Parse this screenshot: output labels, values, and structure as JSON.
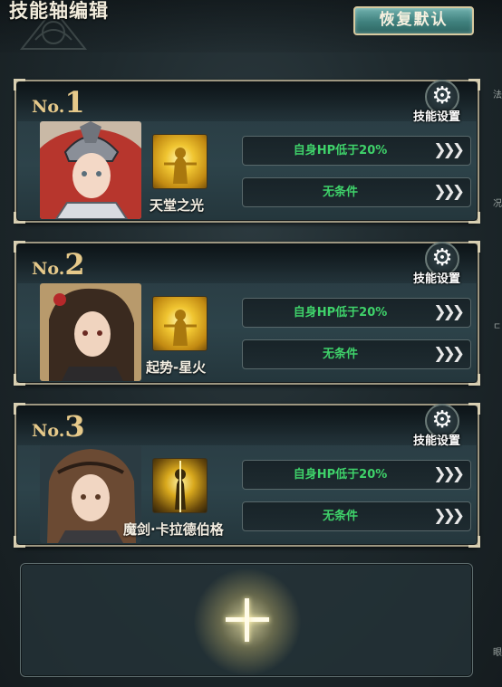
{
  "header": {
    "title": "技能轴编辑",
    "reset_button": "恢复默认"
  },
  "side_fragments": [
    "法",
    "况",
    "ㄷ",
    "眼"
  ],
  "skill_settings_label": "技能设置",
  "arrow_glyph": "❯❯❯",
  "slots": [
    {
      "no_prefix": "No.",
      "number": "1",
      "skill_name": "天堂之光",
      "conditions": [
        {
          "text": "自身HP低于20%",
          "color": "#3fd26a"
        },
        {
          "text": "无条件",
          "color": "#3fd26a"
        }
      ]
    },
    {
      "no_prefix": "No.",
      "number": "2",
      "skill_name": "起势-星火",
      "conditions": [
        {
          "text": "自身HP低于20%",
          "color": "#3fd26a"
        },
        {
          "text": "无条件",
          "color": "#3fd26a"
        }
      ]
    },
    {
      "no_prefix": "No.",
      "number": "3",
      "skill_name": "魔剑·卡拉德伯格",
      "conditions": [
        {
          "text": "自身HP低于20%",
          "color": "#3fd26a"
        },
        {
          "text": "无条件",
          "color": "#3fd26a"
        }
      ]
    }
  ],
  "add_slot": {
    "icon": "plus-icon"
  },
  "colors": {
    "accent_gold": "#e6c98a",
    "condition_green": "#3fd26a",
    "reset_teal": "#4f908d"
  }
}
